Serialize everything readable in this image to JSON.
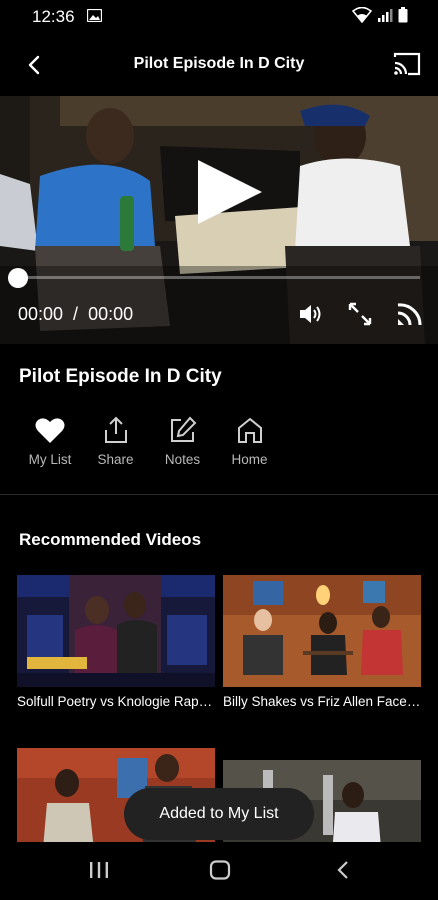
{
  "status": {
    "time": "12:36"
  },
  "header": {
    "title": "Pilot Episode In D City"
  },
  "player": {
    "current_time": "00:00",
    "separator": "/",
    "duration": "00:00",
    "progress": 0
  },
  "video": {
    "title": "Pilot Episode In D City"
  },
  "actions": [
    {
      "label": "My List",
      "icon": "heart-icon"
    },
    {
      "label": "Share",
      "icon": "share-icon"
    },
    {
      "label": "Notes",
      "icon": "edit-icon"
    },
    {
      "label": "Home",
      "icon": "home-icon"
    }
  ],
  "recommended": {
    "heading": "Recommended Videos",
    "items": [
      {
        "title": "Solfull Poetry vs Knologie Rap Battle"
      },
      {
        "title": "Billy Shakes vs Friz Allen Face Off"
      },
      {
        "title": ""
      },
      {
        "title": ""
      }
    ]
  },
  "toast": {
    "text": "Added to My List"
  },
  "colors": {
    "background": "#000000",
    "toast": "#222222",
    "muted_text": "#b9b9b9"
  }
}
